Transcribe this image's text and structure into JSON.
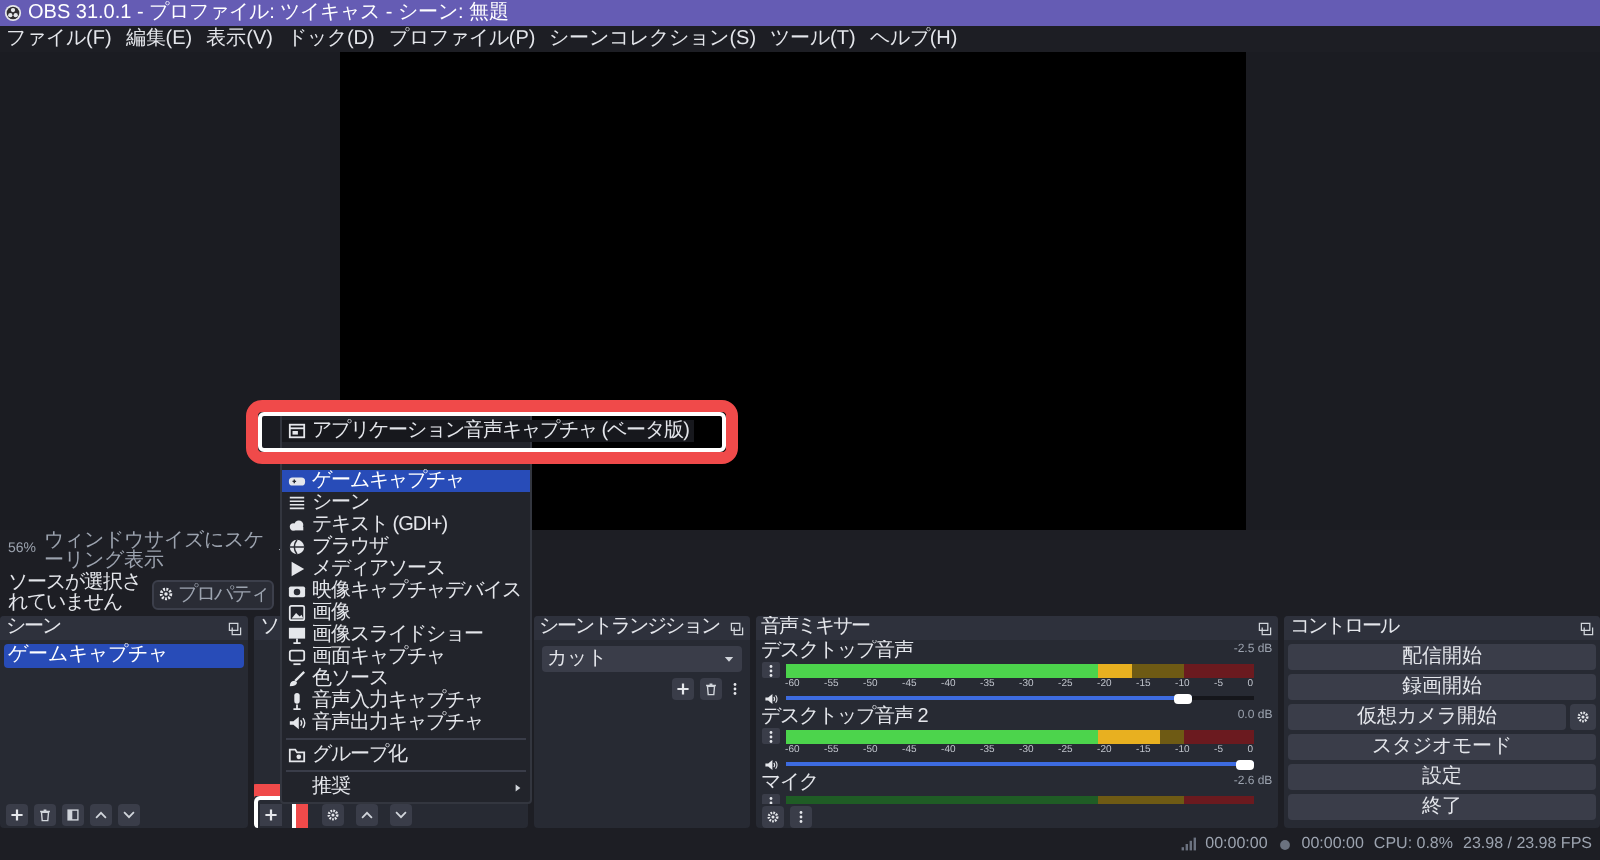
{
  "window": {
    "title": "OBS 31.0.1 - プロファイル: ツイキャス - シーン: 無題"
  },
  "menu_bar": [
    "ファイル(F)",
    "編集(E)",
    "表示(V)",
    "ドック(D)",
    "プロファイル(P)",
    "シーンコレクション(S)",
    "ツール(T)",
    "ヘルプ(H)"
  ],
  "preview": {
    "zoom": "56%",
    "scale_mode": "ウィンドウサイズにスケーリング表示"
  },
  "source_toolbar": {
    "status": "ソースが選択されていません",
    "properties_button": "プロパティ"
  },
  "scenes": {
    "title": "シーン",
    "items": [
      {
        "label": "ゲームキャプチャ",
        "selected": true
      }
    ]
  },
  "sources": {
    "title": "ソ",
    "add_button": {
      "callout": true
    }
  },
  "add_source_menu": {
    "items": [
      {
        "kind": "item",
        "label": "アプリケーション音声キャプチャ (ベータ版)",
        "selected": false,
        "callout": true
      },
      {
        "kind": "item",
        "label": "ゲームキャプチャ",
        "selected": true,
        "callout": false
      },
      {
        "kind": "item",
        "label": "シーン",
        "selected": false,
        "callout": false
      },
      {
        "kind": "item",
        "label": "テキスト (GDI+)",
        "selected": false,
        "callout": false
      },
      {
        "kind": "item",
        "label": "ブラウザ",
        "selected": false,
        "callout": false
      },
      {
        "kind": "item",
        "label": "メディアソース",
        "selected": false,
        "callout": false
      },
      {
        "kind": "item",
        "label": "映像キャプチャデバイス",
        "selected": false,
        "callout": false
      },
      {
        "kind": "item",
        "label": "画像",
        "selected": false,
        "callout": false
      },
      {
        "kind": "item",
        "label": "画像スライドショー",
        "selected": false,
        "callout": false
      },
      {
        "kind": "item",
        "label": "画面キャプチャ",
        "selected": false,
        "callout": false
      },
      {
        "kind": "item",
        "label": "色ソース",
        "selected": false,
        "callout": false
      },
      {
        "kind": "item",
        "label": "音声入力キャプチャ",
        "selected": false,
        "callout": false
      },
      {
        "kind": "item",
        "label": "音声出力キャプチャ",
        "selected": false,
        "callout": false
      },
      {
        "kind": "separator"
      },
      {
        "kind": "item",
        "label": "グループ化",
        "selected": false,
        "callout": false
      },
      {
        "kind": "separator"
      },
      {
        "kind": "submenu",
        "label": "推奨",
        "selected": false,
        "callout": false
      }
    ]
  },
  "transitions": {
    "title": "シーントランジション",
    "select_value": "カット"
  },
  "mixer": {
    "title": "音声ミキサー",
    "channels": [
      {
        "name": "デスクトップ音声",
        "reading": "-2.5 dB",
        "meter": {
          "level": 0.74
        },
        "volume": {
          "level": 0.87
        },
        "scale": [
          "-60",
          "-55",
          "-50",
          "-45",
          "-40",
          "-35",
          "-30",
          "-25",
          "-20",
          "-15",
          "-10",
          "-5",
          "0"
        ]
      },
      {
        "name": "デスクトップ音声 2",
        "reading": "0.0 dB",
        "meter": {
          "level": 0.8
        },
        "volume": {
          "level": 1
        },
        "scale": [
          "-60",
          "-55",
          "-50",
          "-45",
          "-40",
          "-35",
          "-30",
          "-25",
          "-20",
          "-15",
          "-10",
          "-5",
          "0"
        ]
      },
      {
        "name": "マイク",
        "reading": "-2.6 dB",
        "meter": {
          "level": 0
        }
      }
    ]
  },
  "controls": {
    "title": "コントロール",
    "buttons": [
      {
        "label": "配信開始",
        "kind": "plain"
      },
      {
        "label": "録画開始",
        "kind": "plain"
      },
      {
        "label": "仮想カメラ開始",
        "kind": "with_settings"
      },
      {
        "label": "スタジオモード",
        "kind": "plain"
      },
      {
        "label": "設定",
        "kind": "plain"
      },
      {
        "label": "終了",
        "kind": "plain"
      }
    ]
  },
  "status_bar": {
    "stream_time": "00:00:00",
    "record_time": "00:00:00",
    "cpu": "CPU: 0.8%",
    "fps": "23.98 / 23.98 FPS"
  }
}
